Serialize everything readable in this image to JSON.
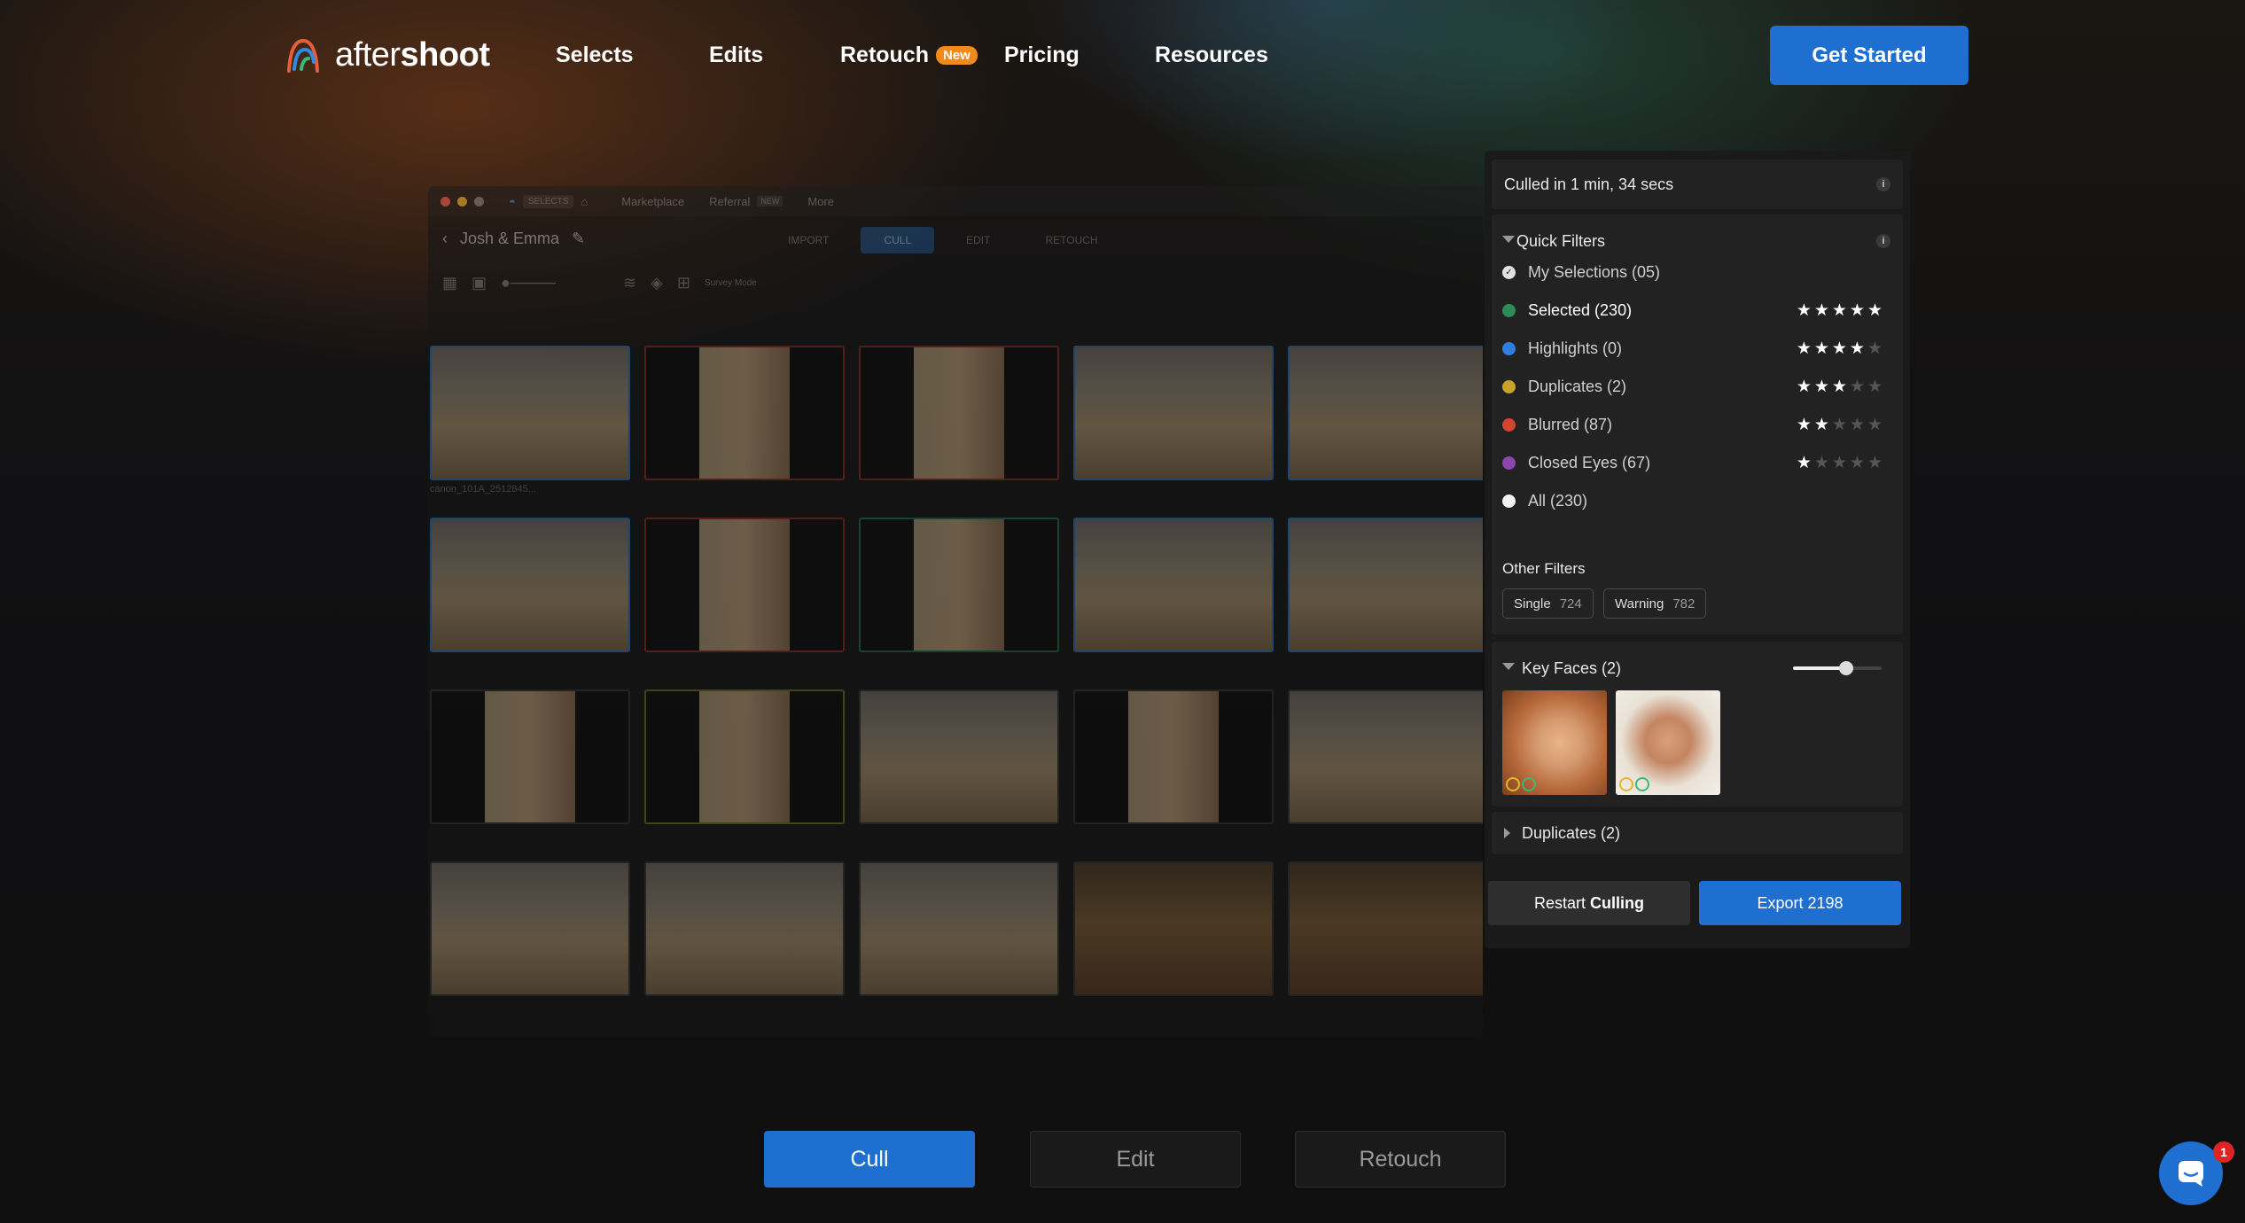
{
  "nav": {
    "logo_prefix": "after",
    "logo_suffix": "shoot",
    "items": [
      {
        "label": "Selects"
      },
      {
        "label": "Edits"
      },
      {
        "label": "Retouch",
        "badge": "New"
      },
      {
        "label": "Pricing"
      },
      {
        "label": "Resources"
      }
    ],
    "cta": "Get Started"
  },
  "app": {
    "title_badge": "SELECTS",
    "menu": [
      "Marketplace",
      "Referral",
      "NEW",
      "More"
    ],
    "project": "Josh & Emma",
    "stages": [
      "IMPORT",
      "CULL",
      "EDIT",
      "RETOUCH"
    ],
    "active_stage": "CULL",
    "tooltip": "Survey Mode",
    "thumbnail_caption": "canon_101A_2512845..."
  },
  "panel": {
    "culled_text": "Culled in 1 min, 34 secs",
    "quick_filters": {
      "title": "Quick Filters",
      "items": [
        {
          "label": "My Selections (05)",
          "color": "#e0e0e0",
          "stars": 0
        },
        {
          "label": "Selected (230)",
          "color": "#2e8b57",
          "stars": 5
        },
        {
          "label": "Highlights (0)",
          "color": "#2f7de1",
          "stars": 4
        },
        {
          "label": "Duplicates (2)",
          "color": "#c9a227",
          "stars": 3
        },
        {
          "label": "Blurred (87)",
          "color": "#d2442e",
          "stars": 2
        },
        {
          "label": "Closed Eyes (67)",
          "color": "#8e44ad",
          "stars": 1
        },
        {
          "label": "All (230)",
          "color": "#f2f2f2",
          "stars": 0
        }
      ]
    },
    "other_filters": {
      "title": "Other Filters",
      "chips": [
        {
          "label": "Single",
          "count": "724"
        },
        {
          "label": "Warning",
          "count": "782"
        }
      ]
    },
    "key_faces": {
      "title": "Key Faces (2)",
      "slider_value": 0.6
    },
    "duplicates": {
      "title": "Duplicates (2)"
    },
    "restart_prefix": "Restart ",
    "restart_bold": "Culling",
    "export_label": "Export 2198"
  },
  "bottom_tabs": [
    {
      "label": "Cull"
    },
    {
      "label": "Edit"
    },
    {
      "label": "Retouch"
    }
  ],
  "chat": {
    "badge_count": "1"
  },
  "colors": {
    "accent": "#1f6fd1",
    "badge_orange": "#f08a1c",
    "notify_red": "#e02424"
  }
}
